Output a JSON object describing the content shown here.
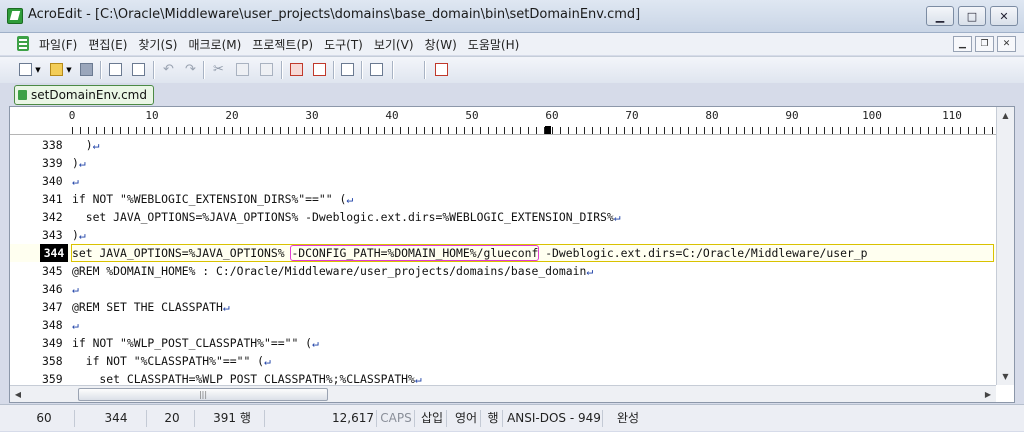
{
  "window": {
    "title": "AcroEdit - [C:\\Oracle\\Middleware\\user_projects\\domains\\base_domain\\bin\\setDomainEnv.cmd]",
    "buttons": [
      "minimize",
      "maximize",
      "close"
    ]
  },
  "menu": {
    "items": [
      "파일(F)",
      "편집(E)",
      "찾기(S)",
      "매크로(M)",
      "프로젝트(P)",
      "도구(T)",
      "보기(V)",
      "창(W)",
      "도움말(H)"
    ]
  },
  "toolbar": {
    "icons": [
      "new-file-icon",
      "dropdown-arrow-icon",
      "open-folder-icon",
      "dropdown-arrow-icon",
      "save-icon",
      "print-preview-icon",
      "print-icon",
      "undo-icon",
      "redo-icon",
      "cut-icon",
      "copy-icon",
      "paste-icon",
      "find-icon",
      "replace-icon",
      "properties-icon",
      "list-icon",
      "calendar-icon"
    ]
  },
  "tabs": [
    {
      "label": "setDomainEnv.cmd"
    }
  ],
  "ruler": {
    "labels": [
      "0",
      "10",
      "20",
      "30",
      "40",
      "50",
      "60",
      "70",
      "80",
      "90",
      "100",
      "110"
    ],
    "cursor_column": 60
  },
  "editor": {
    "return_symbol": "↵",
    "lines": [
      {
        "num": "338",
        "code": "  )"
      },
      {
        "num": "339",
        "code": ")"
      },
      {
        "num": "340",
        "code": ""
      },
      {
        "num": "341",
        "code": "if NOT \"%WEBLOGIC_EXTENSION_DIRS%\"==\"\" ("
      },
      {
        "num": "342",
        "code": "  set JAVA_OPTIONS=%JAVA_OPTIONS% -Dweblogic.ext.dirs=%WEBLOGIC_EXTENSION_DIRS%"
      },
      {
        "num": "343",
        "code": ")"
      },
      {
        "num": "344",
        "code_before": "set JAVA_OPTIONS=%JAVA_OPTIONS% ",
        "code_highlight": "-DCONFIG_PATH=%DOMAIN_HOME%/glueconf",
        "code_after": " -Dweblogic.ext.dirs=C:/Oracle/Middleware/user_p",
        "current": true
      },
      {
        "num": "345",
        "code": "@REM %DOMAIN_HOME% : C:/Oracle/Middleware/user_projects/domains/base_domain"
      },
      {
        "num": "346",
        "code": ""
      },
      {
        "num": "347",
        "code": "@REM SET THE CLASSPATH"
      },
      {
        "num": "348",
        "code": ""
      },
      {
        "num": "349",
        "code": "if NOT \"%WLP_POST_CLASSPATH%\"==\"\" ("
      },
      {
        "num": "358",
        "code": "  if NOT \"%CLASSPATH%\"==\"\" ("
      },
      {
        "num": "359",
        "code": "    set CLASSPATH=%WLP_POST_CLASSPATH%;%CLASSPATH%"
      }
    ]
  },
  "status": {
    "column": "60",
    "line": "344",
    "field3": "20",
    "total_lines": "391 행",
    "bytes": "12,617",
    "caps": "CAPS",
    "insert_mode": "삽입",
    "language": "영어",
    "row_mode": "행",
    "encoding": "ANSI-DOS - 949",
    "state": "완성"
  }
}
